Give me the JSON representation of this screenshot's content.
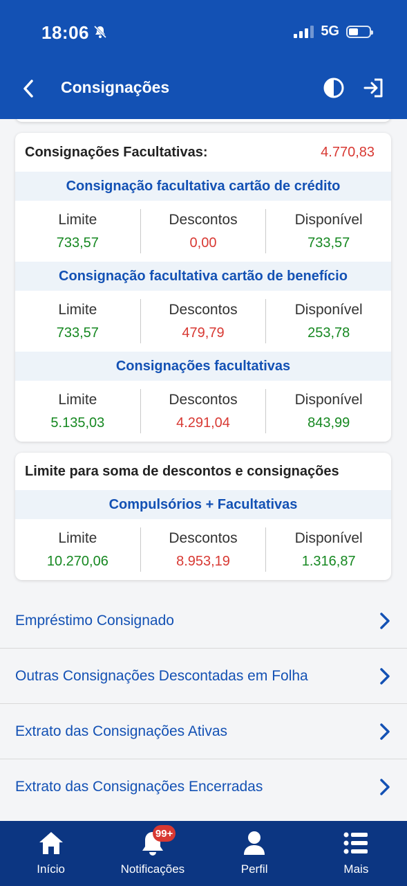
{
  "status_bar": {
    "time": "18:06",
    "network": "5G"
  },
  "header": {
    "title": "Consignações"
  },
  "facultativas_card": {
    "title": "Consignações Facultativas:",
    "total": "4.770,83",
    "sections": [
      {
        "title": "Consignação facultativa cartão de crédito",
        "limite_label": "Limite",
        "limite": "733,57",
        "descontos_label": "Descontos",
        "descontos": "0,00",
        "disponivel_label": "Disponível",
        "disponivel": "733,57"
      },
      {
        "title": "Consignação facultativa cartão de benefício",
        "limite_label": "Limite",
        "limite": "733,57",
        "descontos_label": "Descontos",
        "descontos": "479,79",
        "disponivel_label": "Disponível",
        "disponivel": "253,78"
      },
      {
        "title": "Consignações facultativas",
        "limite_label": "Limite",
        "limite": "5.135,03",
        "descontos_label": "Descontos",
        "descontos": "4.291,04",
        "disponivel_label": "Disponível",
        "disponivel": "843,99"
      }
    ]
  },
  "soma_card": {
    "title": "Limite para soma de descontos e consignações",
    "section": {
      "title": "Compulsórios + Facultativas",
      "limite_label": "Limite",
      "limite": "10.270,06",
      "descontos_label": "Descontos",
      "descontos": "8.953,19",
      "disponivel_label": "Disponível",
      "disponivel": "1.316,87"
    }
  },
  "links": [
    "Empréstimo Consignado",
    "Outras Consignações Descontadas em Folha",
    "Extrato das Consignações Ativas",
    "Extrato das Consignações Encerradas"
  ],
  "bottom_nav": {
    "items": [
      {
        "label": "Início",
        "icon": "home-icon"
      },
      {
        "label": "Notificações",
        "icon": "bell-icon",
        "badge": "99+"
      },
      {
        "label": "Perfil",
        "icon": "person-icon"
      },
      {
        "label": "Mais",
        "icon": "menu-list-icon"
      }
    ]
  },
  "colors": {
    "primary": "#1351b4",
    "nav": "#0c3682",
    "green": "#168821",
    "red": "#d83933"
  }
}
